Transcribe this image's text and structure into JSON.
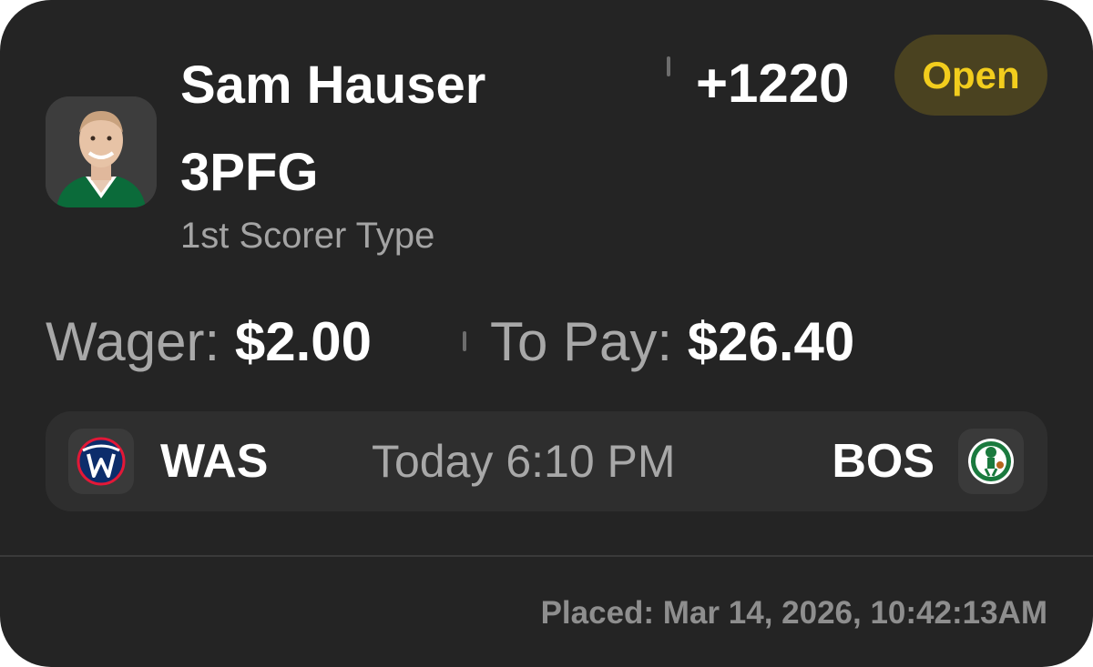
{
  "bet": {
    "player_name": "Sam Hauser",
    "market": "3PFG",
    "bet_type": "1st Scorer Type",
    "odds": "+1220",
    "status": "Open"
  },
  "wager": {
    "wager_label": "Wager:",
    "wager_value": "$2.00",
    "pay_label": "To Pay:",
    "pay_value": "$26.40"
  },
  "game": {
    "away_team": "WAS",
    "away_logo_icon": "wizards-logo-icon",
    "time": "Today 6:10 PM",
    "home_team": "BOS",
    "home_logo_icon": "celtics-logo-icon"
  },
  "footer": {
    "placed": "Placed: Mar 14, 2026, 10:42:13AM"
  },
  "colors": {
    "card_background": "#242424",
    "status_text": "#f2cd1d",
    "status_background": "#4a4220",
    "secondary_text": "#a8a8a8"
  }
}
